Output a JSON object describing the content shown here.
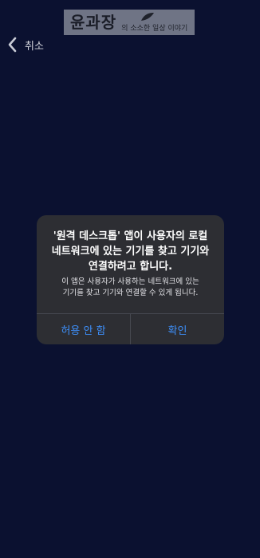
{
  "watermark": {
    "title": "윤과장",
    "subtitle": "의 소소한 일상 이야기"
  },
  "nav": {
    "back_label": "취소",
    "back_icon": "chevron-left-icon"
  },
  "alert": {
    "title": "'원격 데스크톱' 앱이 사용자의 로컬\n네트워크에 있는 기기를 찾고 기기와\n연결하려고 합니다.",
    "message": "이 앱은 사용자가 사용하는 네트워크에 있는\n기기를 찾고 기기와 연결할 수 있게 됩니다.",
    "deny_label": "허용 안 함",
    "confirm_label": "확인"
  },
  "colors": {
    "background": "#0b1130",
    "dialog": "#2d2e33",
    "accent": "#3d8ef7"
  }
}
